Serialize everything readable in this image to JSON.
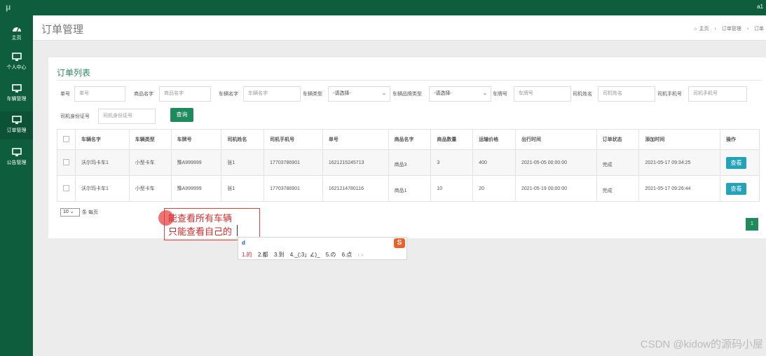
{
  "topbar": {
    "logo": "μ",
    "user": "a1"
  },
  "sidebar": {
    "items": [
      {
        "label": "主页"
      },
      {
        "label": "个人中心"
      },
      {
        "label": "车辆管理"
      },
      {
        "label": "订单管理"
      },
      {
        "label": "公告管理"
      }
    ]
  },
  "header": {
    "title": "订单管理",
    "breadcrumb": {
      "home": "主页",
      "sep": "›",
      "level1": "订单管理",
      "level2": "订单"
    }
  },
  "panel": {
    "title": "订单列表",
    "filters": {
      "order_no": {
        "label": "单号",
        "placeholder": "单号"
      },
      "product_name": {
        "label": "商品名字",
        "placeholder": "商品名字"
      },
      "vehicle_name": {
        "label": "车辆名字",
        "placeholder": "车辆名字"
      },
      "vehicle_type": {
        "label": "车辆类型",
        "value": "-请选择-"
      },
      "vehicle_brand_type": {
        "label": "车辆品牌类型",
        "value": "-请选择-"
      },
      "plate_no": {
        "label": "车牌号",
        "placeholder": "车牌号"
      },
      "driver_name": {
        "label": "司机姓名",
        "placeholder": "司机姓名"
      },
      "driver_phone": {
        "label": "司机手机号",
        "placeholder": "司机手机号"
      },
      "driver_id": {
        "label": "司机身份证号",
        "placeholder": "司机身份证号"
      },
      "query_label": "查询"
    },
    "table": {
      "headers": [
        "车辆名字",
        "车辆类型",
        "车牌号",
        "司机姓名",
        "司机手机号",
        "单号",
        "商品名字",
        "商品数量",
        "运输价格",
        "出行时间",
        "订单状态",
        "添加时间",
        "操作"
      ],
      "rows": [
        {
          "vehicle_name": "沃尔玛卡车1",
          "vehicle_type": "小型卡车",
          "plate": "豫A999999",
          "driver": "张1",
          "phone": "17703786901",
          "order_no": "1621215245713",
          "product": "商品3",
          "qty": "3",
          "price": "400",
          "travel_time": "2021-05-05 00:00:00",
          "status": "完成",
          "added": "2021-05-17 09:34:25",
          "action": "查看"
        },
        {
          "vehicle_name": "沃尔玛卡车1",
          "vehicle_type": "小型卡车",
          "plate": "豫A999999",
          "driver": "张1",
          "phone": "17703786901",
          "order_no": "1621214780116",
          "product": "商品1",
          "qty": "10",
          "price": "20",
          "travel_time": "2021-05-19 00:00:00",
          "status": "完成",
          "added": "2021-05-17 09:26:44",
          "action": "查看"
        }
      ]
    },
    "pagination": {
      "per_page": "10",
      "per_page_suffix": "条 每页",
      "current_page": "1"
    }
  },
  "annotation": {
    "line1": "能查看所有车辆",
    "line2": "只能查看自己的"
  },
  "ime": {
    "input": "d",
    "candidates": [
      "1.的",
      "2.都",
      "3.到",
      "4._(:3」∠)_",
      "5.の",
      "6.点"
    ],
    "arrows": "‹ ›",
    "logo": "S"
  },
  "watermark": "CSDN @kidow的源码小屋"
}
